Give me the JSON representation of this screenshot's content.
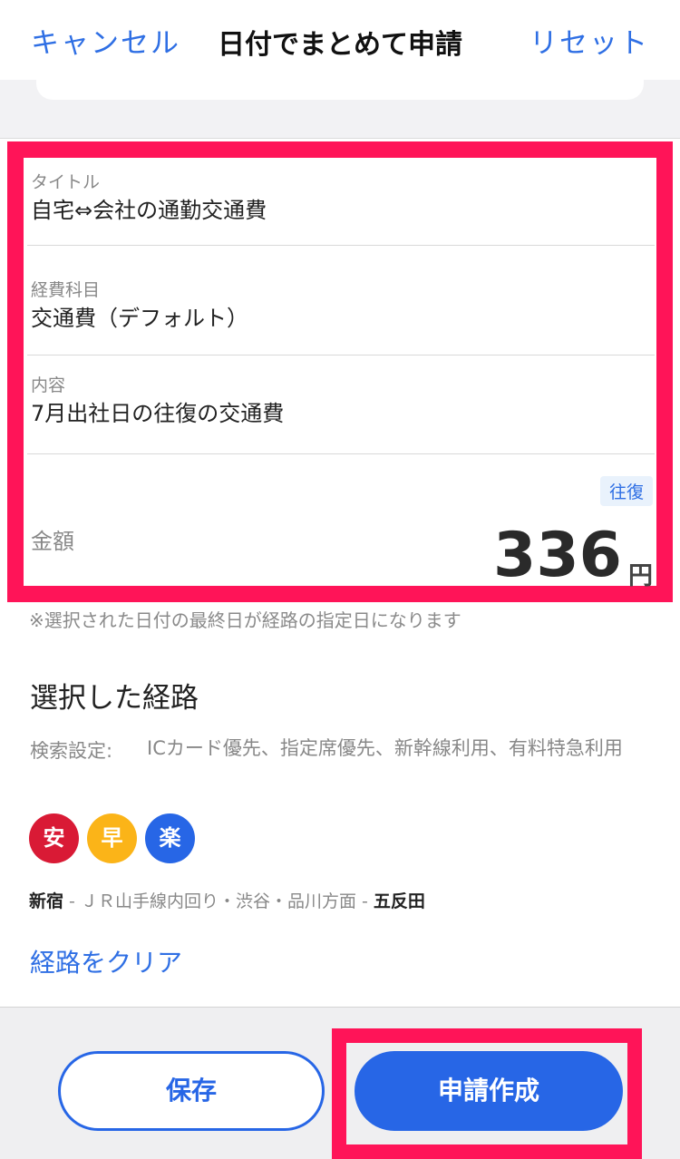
{
  "nav": {
    "cancel_label": "キャンセル",
    "title": "日付でまとめて申請",
    "reset_label": "リセット"
  },
  "form": {
    "title_field": {
      "label": "タイトル",
      "value": "自宅⇔会社の通勤交通費"
    },
    "category_field": {
      "label": "経費科目",
      "value": "交通費（デフォルト）"
    },
    "content_field": {
      "label": "内容",
      "value": "7月出社日の往復の交通費"
    },
    "amount_field": {
      "label": "金額",
      "badge": "往復",
      "value": "336",
      "unit": "円"
    }
  },
  "note": "※選択された日付の最終日が経路の指定日になります",
  "route": {
    "heading": "選択した経路",
    "search_label": "検索設定:",
    "search_value": "ICカード優先、指定席優先、新幹線利用、有料特急利用",
    "badges": [
      "安",
      "早",
      "楽"
    ],
    "origin": "新宿",
    "separator1": " - ",
    "line": "ＪＲ山手線内回り・渋谷・品川方面",
    "separator2": " - ",
    "destination": "五反田",
    "clear_label": "経路をクリア"
  },
  "footer": {
    "save_label": "保存",
    "submit_label": "申請作成"
  },
  "colors": {
    "accent": "#2766e6",
    "highlight": "#ff1458",
    "badge_cheap": "#d91a35",
    "badge_fast": "#fbb418",
    "badge_easy": "#2766e6"
  }
}
